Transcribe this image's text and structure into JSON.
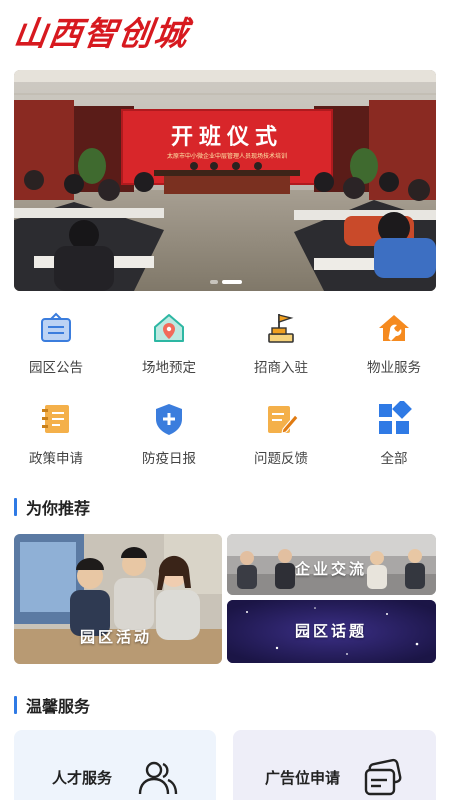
{
  "header": {
    "logo_text": "山西智创城"
  },
  "banner": {
    "sign_title": "开班仪式",
    "sign_subtitle": "太原市中小微企业中层管理人员现场技术培训",
    "slides_count": 2,
    "active_slide": 2
  },
  "quick_menu": [
    {
      "label": "园区公告",
      "icon": "notice-board-icon",
      "color": "#3b7ddd"
    },
    {
      "label": "场地预定",
      "icon": "location-house-icon",
      "color": "#2db7a3"
    },
    {
      "label": "招商入驻",
      "icon": "flag-building-icon",
      "color": "#f0a020"
    },
    {
      "label": "物业服务",
      "icon": "house-wrench-icon",
      "color": "#f58a1f"
    },
    {
      "label": "政策申请",
      "icon": "notebook-icon",
      "color": "#f0a030"
    },
    {
      "label": "防疫日报",
      "icon": "shield-plus-icon",
      "color": "#3b7ddd"
    },
    {
      "label": "问题反馈",
      "icon": "edit-note-icon",
      "color": "#f0a020"
    },
    {
      "label": "全部",
      "icon": "grid-apps-icon",
      "color": "#2f7ae5"
    }
  ],
  "recommend": {
    "title": "为你推荐",
    "cards": [
      {
        "label": "园区活动"
      },
      {
        "label": "企业交流"
      },
      {
        "label": "园区话题"
      }
    ]
  },
  "services": {
    "title": "温馨服务",
    "items": [
      {
        "label": "人才服务",
        "icon": "people-icon",
        "bg": "#eef4fc"
      },
      {
        "label": "广告位申请",
        "icon": "cards-icon",
        "bg": "#eeeef8"
      }
    ]
  }
}
